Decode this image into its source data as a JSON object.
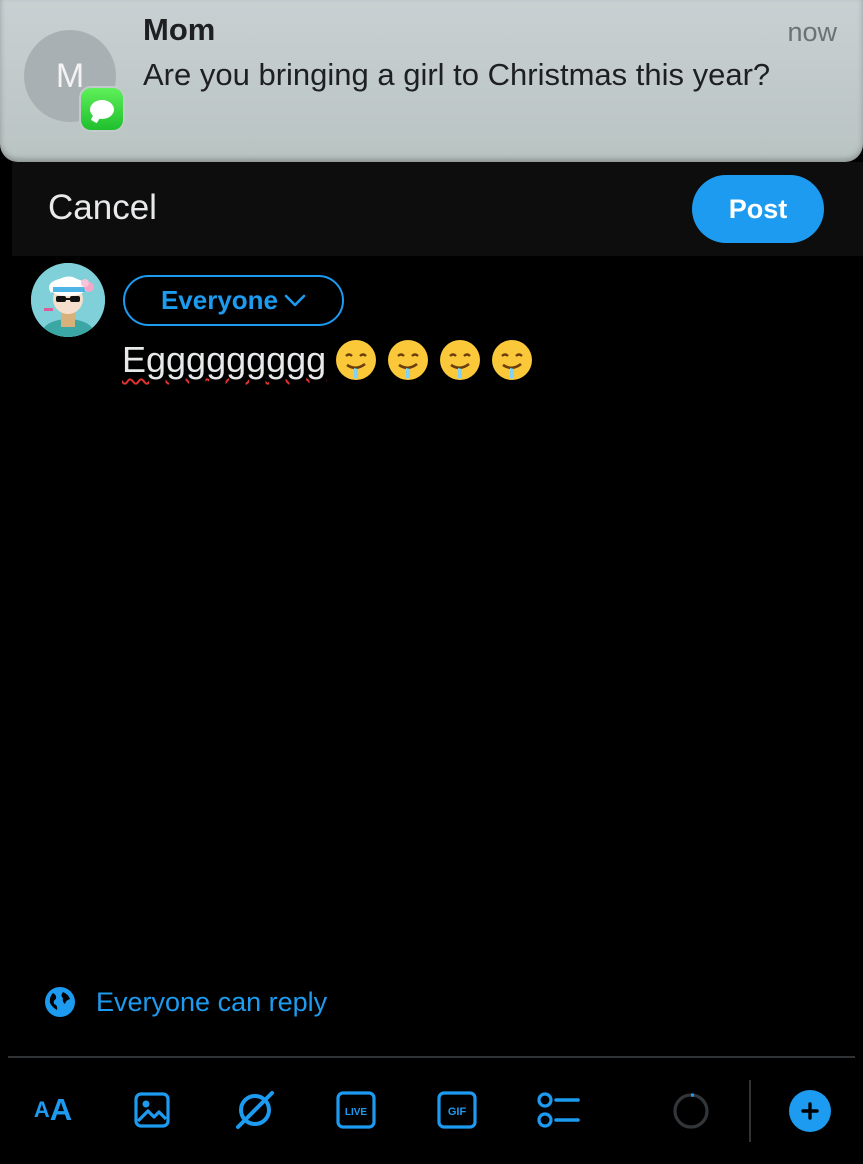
{
  "notification": {
    "sender": "Mom",
    "avatar_initial": "M",
    "time": "now",
    "message": "Are you bringing a girl to Christmas this year?",
    "app_icon": "messages-icon"
  },
  "composer": {
    "cancel_label": "Cancel",
    "post_label": "Post",
    "audience_label": "Everyone",
    "text": "Eggggggggg",
    "emojis": [
      "🤤",
      "🤤",
      "🤤",
      "🤤"
    ],
    "reply_setting": "Everyone can reply"
  },
  "toolbar": {
    "text_size_label_small": "A",
    "text_size_label_large": "A",
    "icons": [
      "text-size-icon",
      "image-icon",
      "grok-icon",
      "live-icon",
      "gif-icon",
      "poll-icon",
      "character-counter-icon",
      "add-thread-icon"
    ],
    "live_label": "LIVE",
    "gif_label": "GIF"
  },
  "colors": {
    "accent": "#1d9bf0",
    "background": "#000000",
    "notification_bg": "#c3cbcc"
  }
}
